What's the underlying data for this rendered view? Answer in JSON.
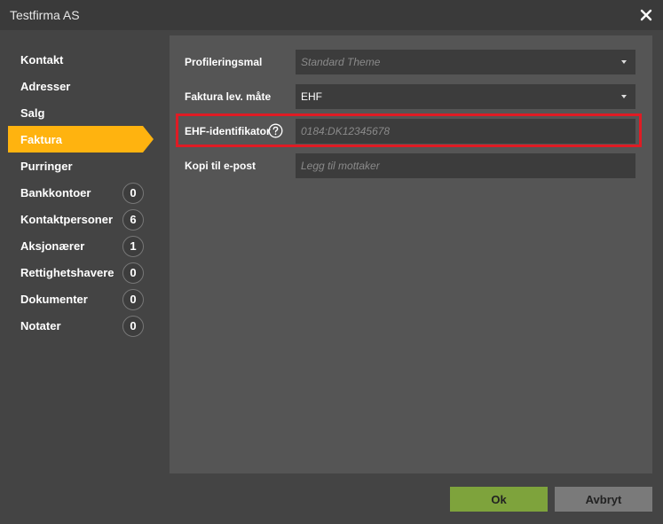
{
  "window": {
    "title": "Testfirma AS"
  },
  "sidebar": {
    "items": [
      {
        "label": "Kontakt"
      },
      {
        "label": "Adresser"
      },
      {
        "label": "Salg"
      },
      {
        "label": "Faktura"
      },
      {
        "label": "Purringer"
      },
      {
        "label": "Bankkontoer",
        "count": "0"
      },
      {
        "label": "Kontaktpersoner",
        "count": "6"
      },
      {
        "label": "Aksjonærer",
        "count": "1"
      },
      {
        "label": "Rettighetshavere",
        "count": "0"
      },
      {
        "label": "Dokumenter",
        "count": "0"
      },
      {
        "label": "Notater",
        "count": "0"
      }
    ],
    "active_index": 3
  },
  "form": {
    "profileringsmal": {
      "label": "Profileringsmal",
      "placeholder": "Standard Theme"
    },
    "faktura_lev_mate": {
      "label": "Faktura lev. måte",
      "value": "EHF"
    },
    "ehf_identifikator": {
      "label": "EHF-identifikator",
      "placeholder": "0184:DK12345678"
    },
    "kopi_til_epost": {
      "label": "Kopi til e-post",
      "placeholder": "Legg til mottaker"
    }
  },
  "footer": {
    "ok_label": "Ok",
    "cancel_label": "Avbryt"
  },
  "colors": {
    "accent": "#ffb30f",
    "ok_button": "#7ea33c",
    "cancel_button": "#7a7a7a",
    "highlight_border": "#e01b24"
  }
}
